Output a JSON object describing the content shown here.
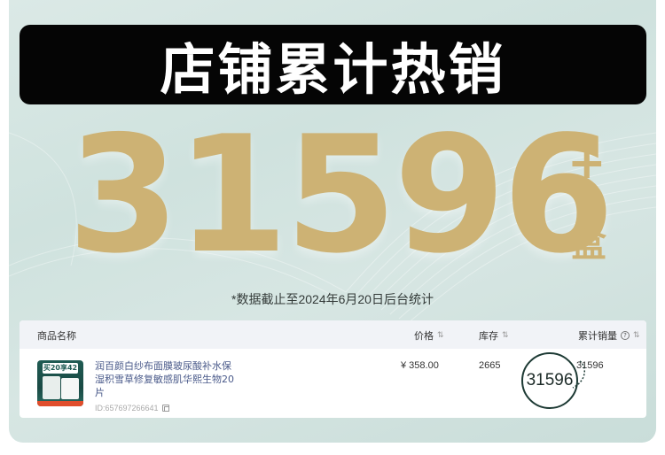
{
  "title": "店铺累计热销",
  "hero": {
    "count": "31596",
    "plus": "+",
    "unit": "盒"
  },
  "note": "*数据截止至2024年6月20日后台统计",
  "table": {
    "headers": {
      "product": "商品名称",
      "price": "价格",
      "stock": "库存",
      "sales": "累计销量"
    },
    "sort_icon": "⇅",
    "rows": [
      {
        "name": "润百颜白纱布面膜玻尿酸补水保湿积雪草修复敏感肌华熙生物20片",
        "id": "ID:657697266641",
        "price": "¥ 358.00",
        "stock": "2665",
        "sales": "31596",
        "thumb_badge": "买20享42"
      }
    ]
  },
  "highlight": "31596",
  "colors": {
    "gold": "#cdb274",
    "title_bg": "#050505",
    "card_bg": "#d3e4e0",
    "link": "#4a5a8a"
  },
  "icons": [
    "help-icon",
    "sort-icon",
    "copy-icon"
  ]
}
